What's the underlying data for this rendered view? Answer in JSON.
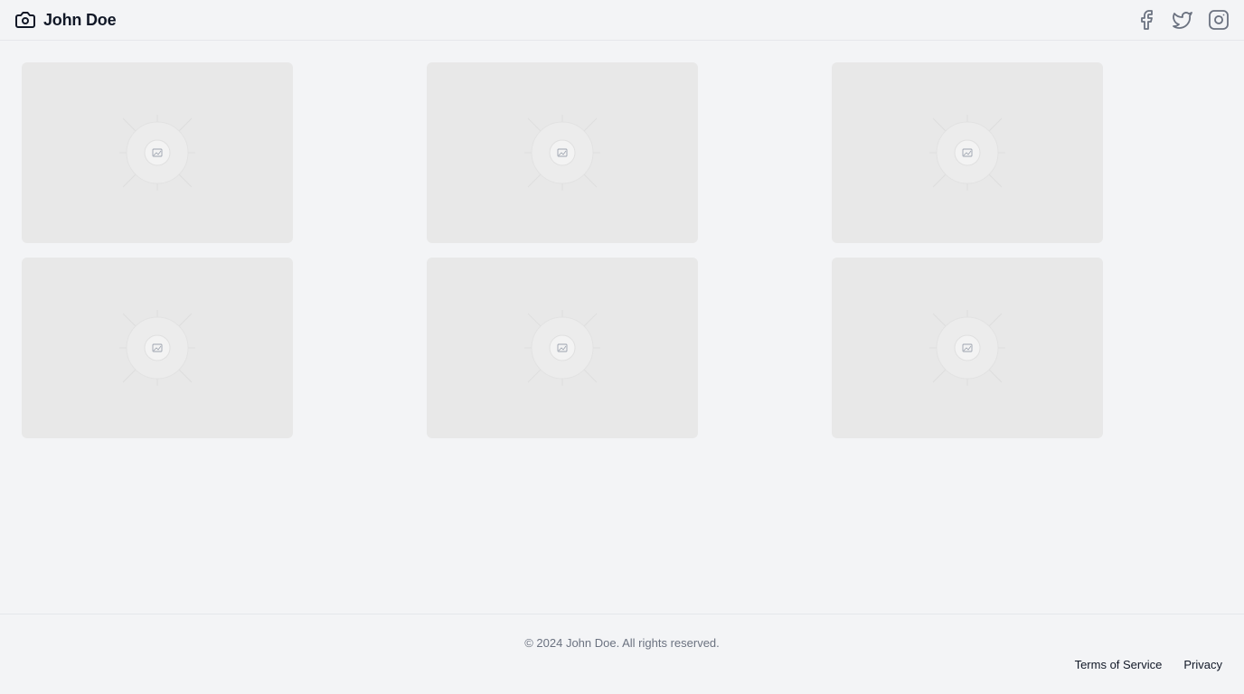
{
  "header": {
    "brand_icon": "camera-icon",
    "brand_name": "John Doe",
    "social": [
      {
        "name": "facebook",
        "icon": "facebook-icon"
      },
      {
        "name": "twitter",
        "icon": "twitter-icon"
      },
      {
        "name": "instagram",
        "icon": "instagram-icon"
      }
    ]
  },
  "gallery": {
    "items": [
      {
        "icon": "image-placeholder-icon"
      },
      {
        "icon": "image-placeholder-icon"
      },
      {
        "icon": "image-placeholder-icon"
      },
      {
        "icon": "image-placeholder-icon"
      },
      {
        "icon": "image-placeholder-icon"
      },
      {
        "icon": "image-placeholder-icon"
      }
    ]
  },
  "footer": {
    "copyright": "© 2024 John Doe. All rights reserved.",
    "links": [
      "Terms of Service",
      "Privacy"
    ]
  },
  "colors": {
    "background": "#f3f4f6",
    "card": "#e8e8e8",
    "icon_gray": "#6b7280",
    "border": "#e5e7eb"
  }
}
